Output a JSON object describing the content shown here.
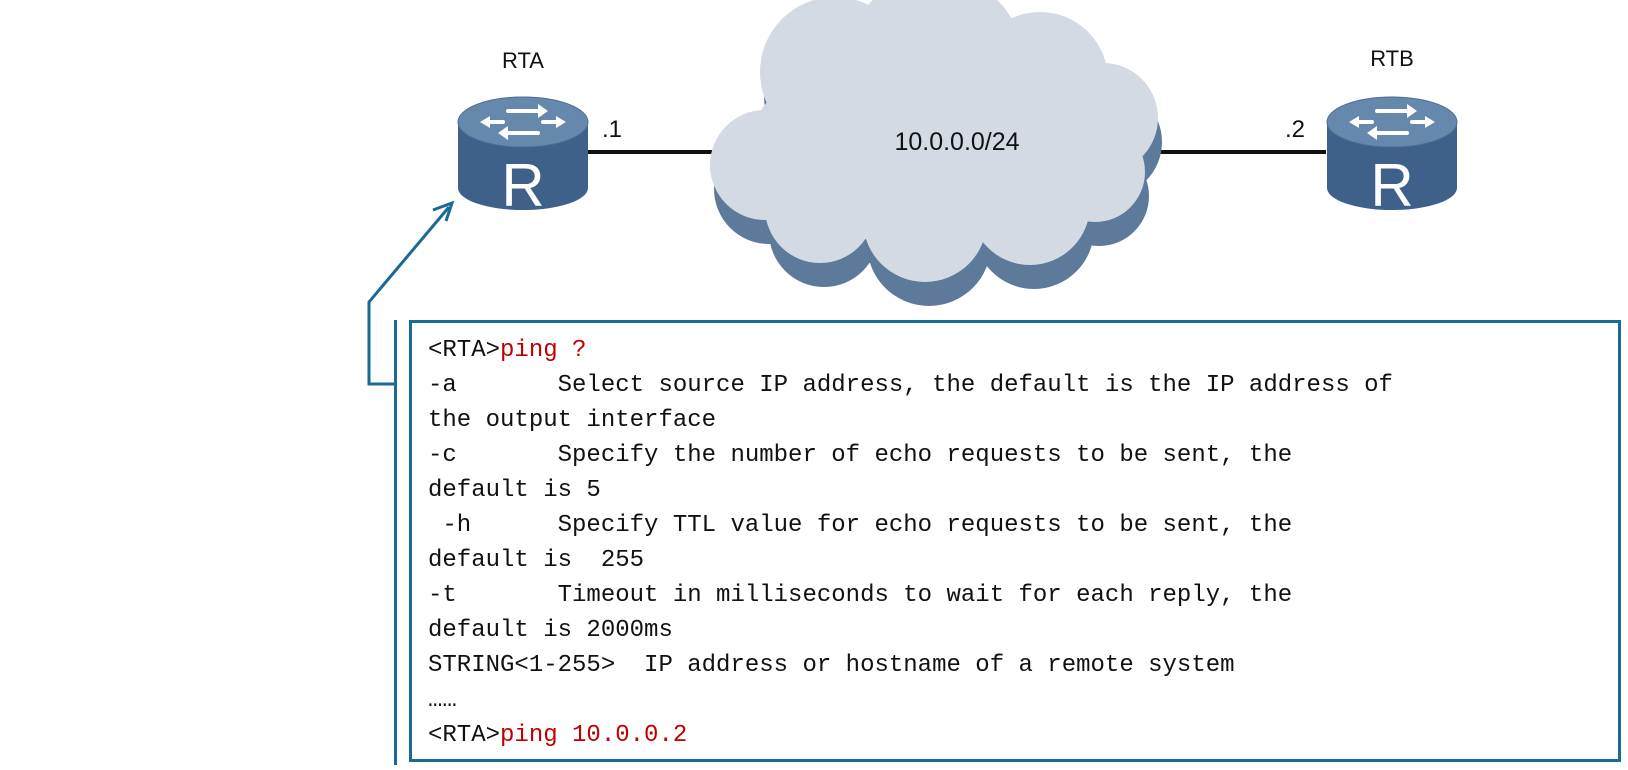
{
  "colors": {
    "accent": "#1a6a96",
    "command": "#c00000",
    "cloud": "#d3dae4",
    "cloud_shadow": "#5d7a9a",
    "router_top": "#6688ad",
    "router_body": "#3f6088",
    "link": "#111111"
  },
  "icons": {
    "router_a": "router-icon",
    "router_b": "router-icon",
    "cloud": "cloud-icon",
    "callout": "callout-arrow-icon"
  },
  "routers": {
    "rta": {
      "name": "RTA",
      "symbol": "R",
      "interface": ".1"
    },
    "rtb": {
      "name": "RTB",
      "symbol": "R",
      "interface": ".2"
    }
  },
  "network": {
    "label": "10.0.0.0/24"
  },
  "terminal": {
    "lines": [
      {
        "prompt": "<RTA>",
        "text": "ping ?",
        "is_command": true
      },
      {
        "prompt": "",
        "text": "-a       Select source IP address, the default is the IP address of",
        "is_command": false
      },
      {
        "prompt": "",
        "text": "the output interface",
        "is_command": false
      },
      {
        "prompt": "",
        "text": "-c       Specify the number of echo requests to be sent, the",
        "is_command": false
      },
      {
        "prompt": "",
        "text": "default is 5",
        "is_command": false
      },
      {
        "prompt": "",
        "text": " -h      Specify TTL value for echo requests to be sent, the",
        "is_command": false
      },
      {
        "prompt": "",
        "text": "default is  255",
        "is_command": false
      },
      {
        "prompt": "",
        "text": "-t       Timeout in milliseconds to wait for each reply, the",
        "is_command": false
      },
      {
        "prompt": "",
        "text": "default is 2000ms",
        "is_command": false
      },
      {
        "prompt": "",
        "text": "STRING<1-255>  IP address or hostname of a remote system",
        "is_command": false
      },
      {
        "prompt": "",
        "text": "……",
        "is_command": false
      },
      {
        "prompt": "<RTA>",
        "text": "ping 10.0.0.2",
        "is_command": true
      }
    ]
  }
}
